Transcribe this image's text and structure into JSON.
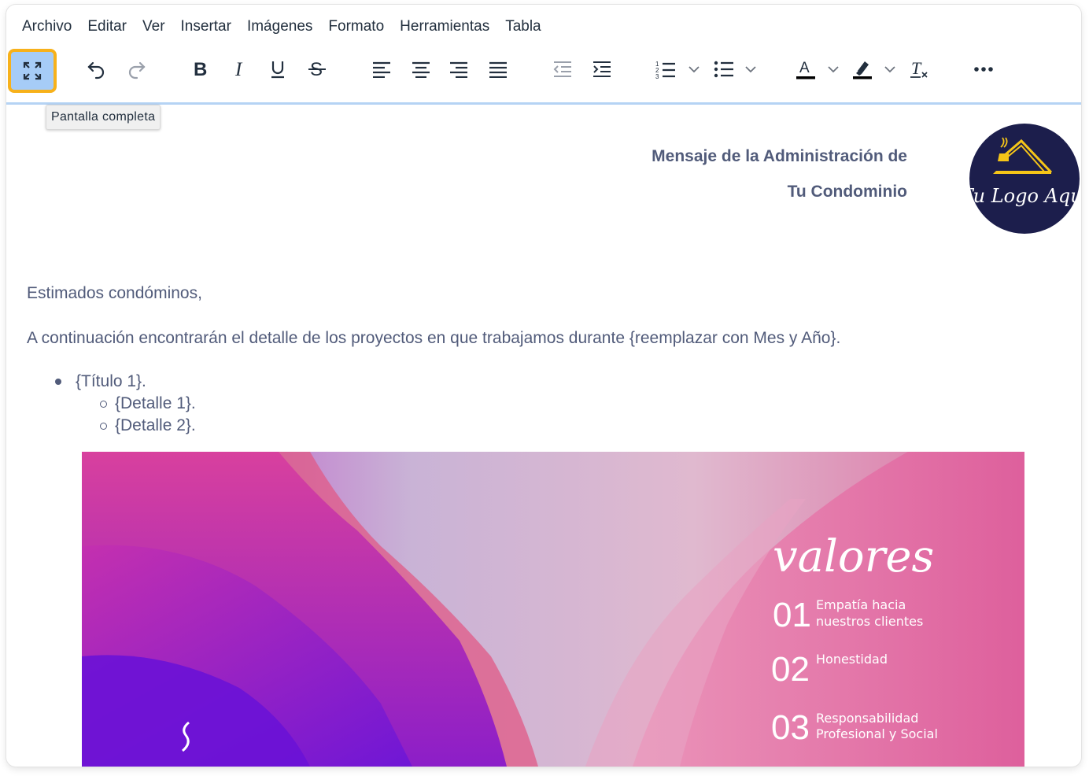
{
  "menubar": {
    "items": [
      "Archivo",
      "Editar",
      "Ver",
      "Insertar",
      "Imágenes",
      "Formato",
      "Herramientas",
      "Tabla"
    ]
  },
  "toolbar": {
    "buttons": [
      {
        "name": "fullscreen",
        "icon": "fullscreen-icon",
        "active": true
      },
      {
        "name": "undo",
        "icon": "undo-icon"
      },
      {
        "name": "redo",
        "icon": "redo-icon"
      },
      {
        "name": "bold",
        "icon": "bold-icon"
      },
      {
        "name": "italic",
        "icon": "italic-icon"
      },
      {
        "name": "underline",
        "icon": "underline-icon"
      },
      {
        "name": "strikethrough",
        "icon": "strikethrough-icon"
      },
      {
        "name": "align-left",
        "icon": "align-left-icon"
      },
      {
        "name": "align-center",
        "icon": "align-center-icon"
      },
      {
        "name": "align-right",
        "icon": "align-right-icon"
      },
      {
        "name": "justify",
        "icon": "align-justify-icon"
      },
      {
        "name": "outdent",
        "icon": "outdent-icon"
      },
      {
        "name": "indent",
        "icon": "indent-icon"
      },
      {
        "name": "numbered-list",
        "icon": "numbered-list-icon"
      },
      {
        "name": "bullet-list",
        "icon": "bullet-list-icon"
      },
      {
        "name": "text-color",
        "icon": "text-color-icon"
      },
      {
        "name": "highlight",
        "icon": "highlight-icon"
      },
      {
        "name": "clear-formatting",
        "icon": "clear-formatting-icon"
      },
      {
        "name": "more",
        "icon": "more-icon"
      }
    ],
    "tooltip": "Pantalla completa",
    "colors": {
      "active_bg": "#a6ccf7",
      "active_border": "#f7b11b"
    }
  },
  "document": {
    "heading_line1": "Mensaje de la Administración de",
    "heading_line2": "Tu Condominio",
    "logo_text": "Tu Logo Aquí",
    "greeting": "Estimados condóminos,",
    "intro": "A continuación encontrarán el detalle de los proyectos en que trabajamos durante {reemplazar con Mes y Año}.",
    "list": {
      "item": "{Título 1}.",
      "subitems": [
        "{Detalle 1}.",
        "{Detalle 2}."
      ]
    },
    "banner": {
      "title": "valores",
      "values": [
        {
          "num": "01",
          "line1": "Empatía hacia",
          "line2": "nuestros clientes"
        },
        {
          "num": "02",
          "line1": "Honestidad",
          "line2": ""
        },
        {
          "num": "03",
          "line1": "Responsabilidad",
          "line2": "Profesional y Social"
        }
      ]
    }
  },
  "colors": {
    "text": "#515b7a",
    "logo_bg": "#1c1e4c",
    "logo_accent": "#f5c518"
  }
}
